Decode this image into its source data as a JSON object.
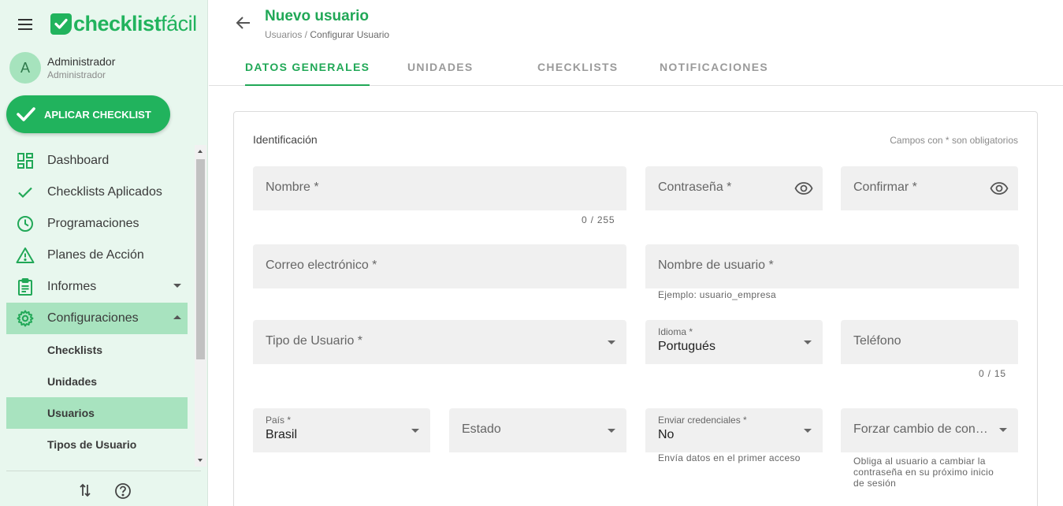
{
  "sidebar": {
    "logo_main": "checklist",
    "logo_light": "fácil",
    "user": {
      "initial": "A",
      "name": "Administrador",
      "role": "Administrador"
    },
    "apply_button": "APLICAR CHECKLIST",
    "items": [
      {
        "label": "Dashboard",
        "icon": "dashboard-icon"
      },
      {
        "label": "Checklists Aplicados",
        "icon": "check-icon"
      },
      {
        "label": "Programaciones",
        "icon": "clock-icon"
      },
      {
        "label": "Planes de Acción",
        "icon": "warning-icon"
      },
      {
        "label": "Informes",
        "icon": "clipboard-icon"
      },
      {
        "label": "Configuraciones",
        "icon": "gear-icon"
      }
    ],
    "sub_items": [
      "Checklists",
      "Unidades",
      "Usuarios",
      "Tipos de Usuario"
    ]
  },
  "header": {
    "title": "Nuevo usuario",
    "breadcrumb_parent": "Usuarios /",
    "breadcrumb_current": "Configurar Usuario"
  },
  "tabs": [
    "DATOS GENERALES",
    "UNIDADES",
    "CHECKLISTS",
    "NOTIFICACIONES"
  ],
  "form": {
    "section_title": "Identificación",
    "required_note": "Campos con * son obligatorios",
    "nombre": {
      "label": "Nombre *",
      "counter": "0 / 255"
    },
    "contrasena": {
      "label": "Contraseña *"
    },
    "confirmar": {
      "label": "Confirmar *"
    },
    "correo": {
      "label": "Correo electrónico *"
    },
    "usuario": {
      "label": "Nombre de usuario *",
      "hint": "Ejemplo: usuario_empresa"
    },
    "tipo_usuario": {
      "label": "Tipo de Usuario *"
    },
    "idioma": {
      "label": "Idioma *",
      "value": "Portugués"
    },
    "telefono": {
      "label": "Teléfono",
      "counter": "0 / 15"
    },
    "pais": {
      "label": "País *",
      "value": "Brasil"
    },
    "estado": {
      "label": "Estado"
    },
    "credenciales": {
      "label": "Enviar credenciales *",
      "value": "No",
      "hint": "Envía datos en el primer acceso"
    },
    "forzar": {
      "label": "Forzar cambio de contraseña",
      "hint_lines": [
        "Obliga al usuario a cambiar la",
        "contraseña en su próximo inicio",
        "de sesión"
      ]
    }
  },
  "colors": {
    "brand_green": "#21b35d",
    "sidebar_bg": "#e8f7ee",
    "active_bg": "#a8e3bf"
  }
}
